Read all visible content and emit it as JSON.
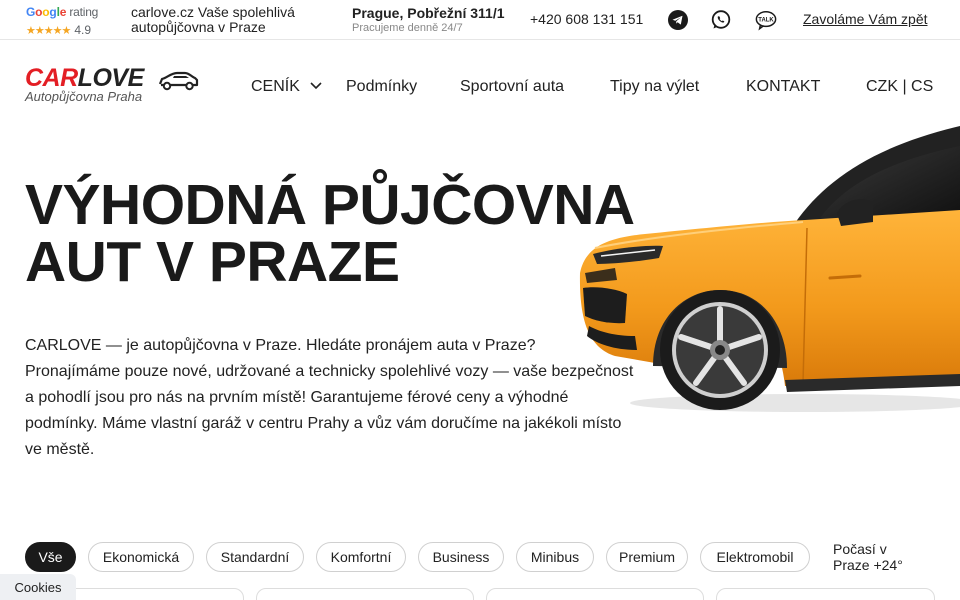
{
  "topbar": {
    "rating": {
      "brand_g": "G",
      "brand_o1": "o",
      "brand_o2": "o",
      "brand_g2": "g",
      "brand_l": "l",
      "brand_e": "e",
      "rating_word": "rating",
      "stars": "★★★★★",
      "score": "4.9"
    },
    "tagline": "carlove.cz  Vaše spolehlivá autopůjčovna v Praze",
    "address": "Prague, Pobřežní 311/1",
    "hours": "Pracujeme denně 24/7",
    "phone": "+420 608 131 151",
    "callback": "Zavoláme Vám zpět",
    "icons": [
      "telegram-icon",
      "whatsapp-icon",
      "kakaotalk-icon"
    ]
  },
  "logo": {
    "car": "CAR",
    "love": "LOVE",
    "subtitle": "Autopůjčovna Praha"
  },
  "nav": {
    "items": [
      "CENÍK",
      "Podmínky",
      "Sportovní auta",
      "Tipy na výlet",
      "KONTAKT"
    ],
    "currency_lang": "CZK | CS"
  },
  "hero": {
    "title_line1": "VÝHODNÁ PŮJČOVNA",
    "title_line2": "AUT V PRAZE",
    "text": "CARLOVE — je autopůjčovna v Praze. Hledáte pronájem auta v Praze? Pronajímáme pouze nové, udržované a technicky spolehlivé vozy — vaše bezpečnost a pohodlí jsou pro nás na prvním místě! Garantujeme férové ceny a výhodné podmínky. Máme vlastní garáž v centru Prahy a vůz vám doručíme na jakékoli místo ve městě."
  },
  "filters": {
    "chips": [
      "Vše",
      "Ekonomická",
      "Standardní",
      "Komfortní",
      "Business",
      "Minibus",
      "Premium",
      "Elektromobil"
    ],
    "active": "Vše"
  },
  "weather": {
    "line1": "Počasí v",
    "line2": "Praze +24°"
  },
  "cookies": "Cookies",
  "colors": {
    "brand_red": "#e31e24",
    "car_orange": "#f39a1c",
    "dark": "#1a1a1a"
  }
}
